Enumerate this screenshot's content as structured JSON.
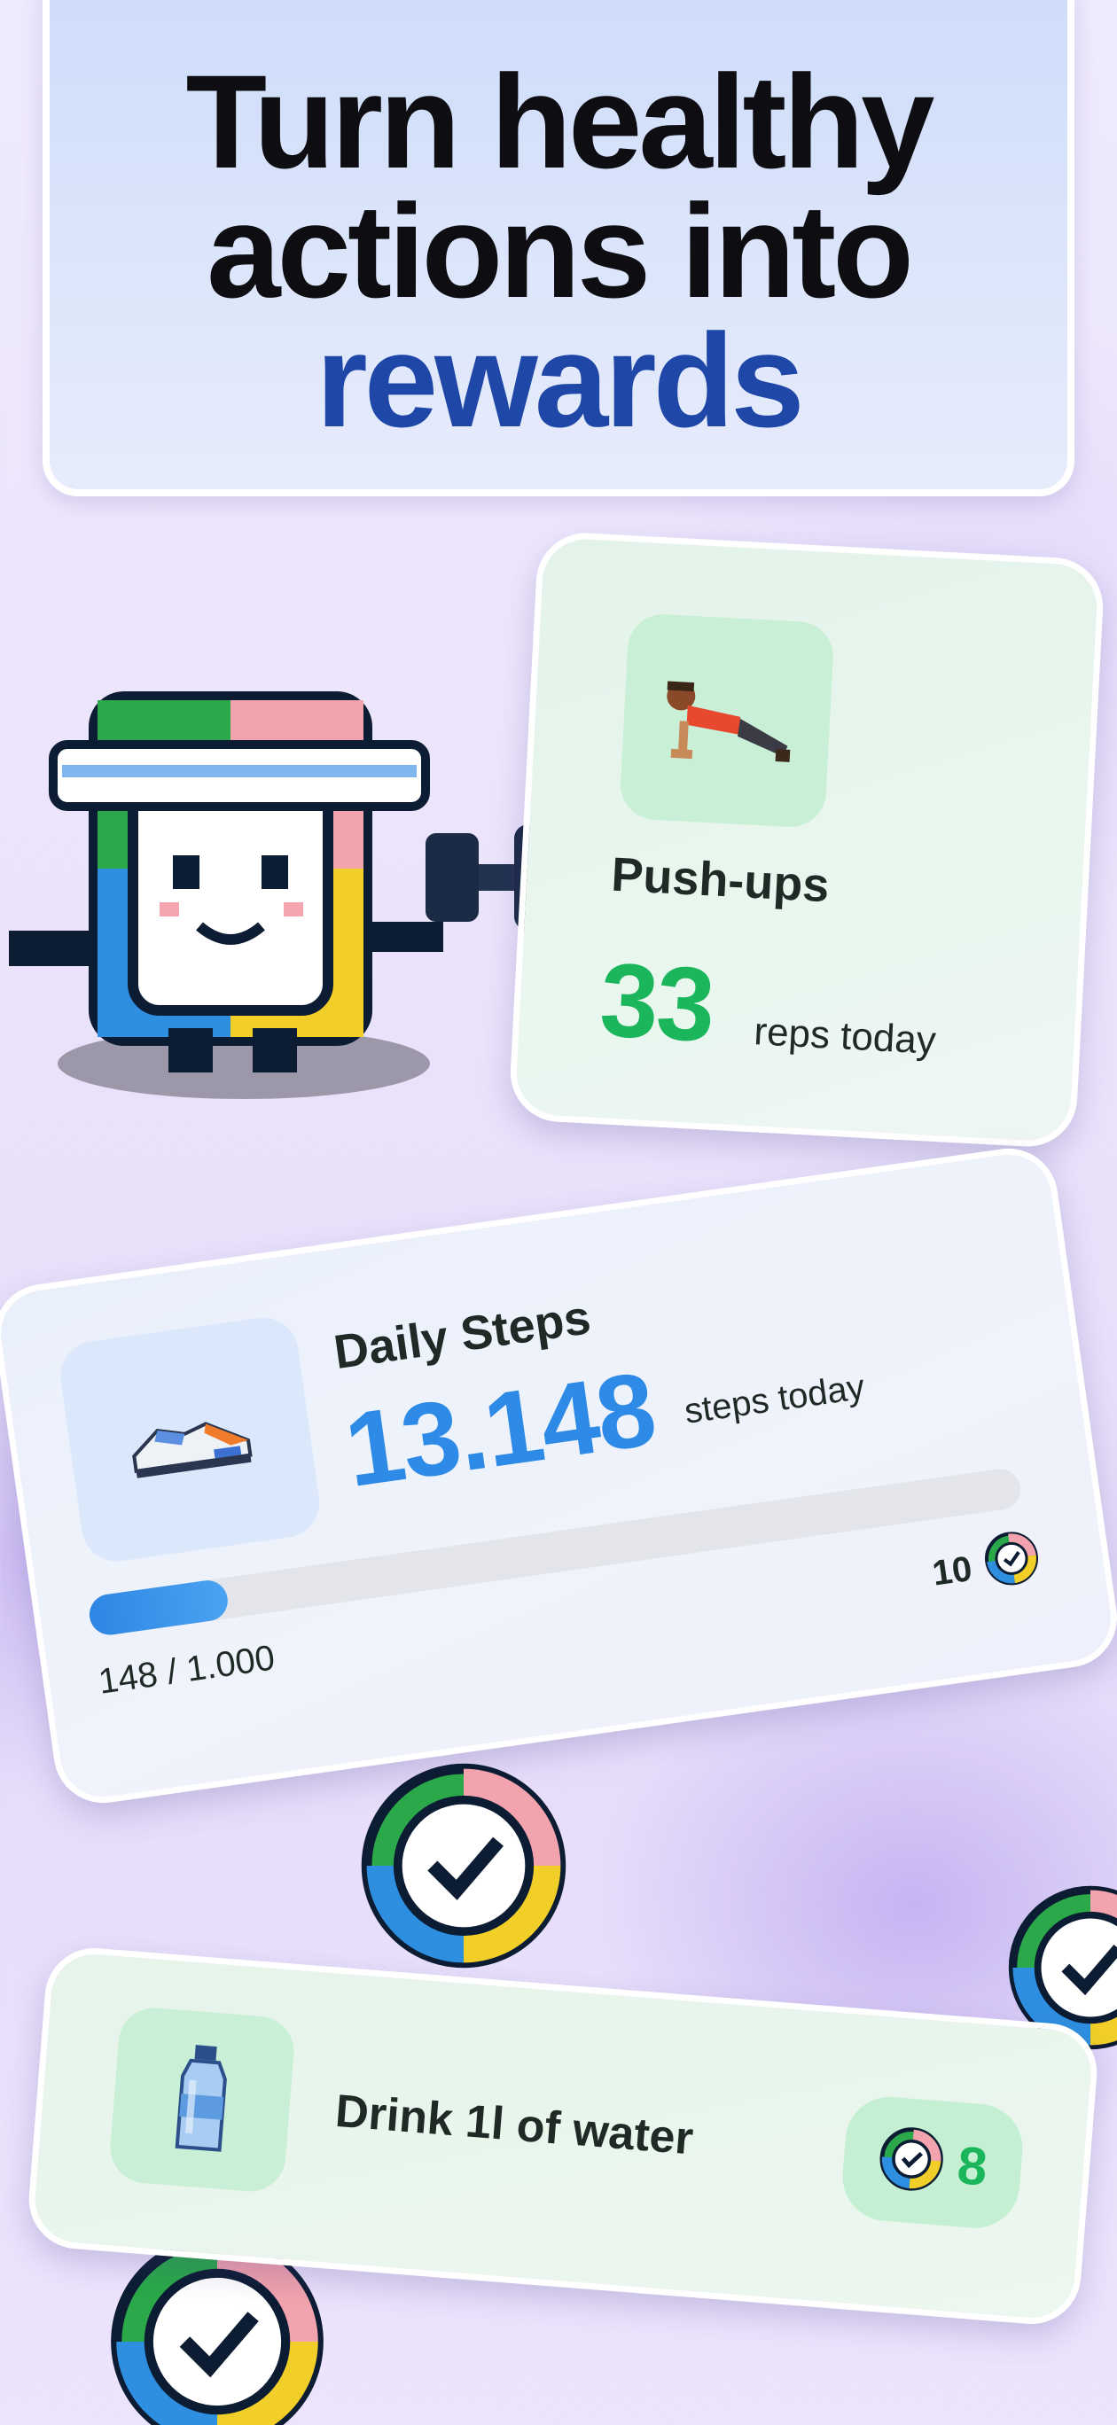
{
  "hero": {
    "line1": "Turn healthy",
    "line2": "actions into",
    "line3": "rewards"
  },
  "pushups": {
    "icon": "person-pushup-icon",
    "title": "Push-ups",
    "count": "33",
    "unit": "reps today"
  },
  "steps": {
    "icon": "sneaker-icon",
    "title": "Daily Steps",
    "count": "13.148",
    "unit": "steps today",
    "progress_text": "148 / 1.000",
    "progress_fraction": 0.148,
    "reward_value": "10",
    "reward_icon": "check-coin-icon"
  },
  "water": {
    "icon": "water-bottle-icon",
    "title": "Drink 1l of water",
    "reward_value": "8",
    "reward_icon": "check-coin-icon"
  },
  "mascot": {
    "icon": "coin-mascot-dumbbell-icon"
  },
  "colors": {
    "brand_blue": "#1e47a8",
    "green": "#1bb55c",
    "blue": "#2d8ae6"
  }
}
